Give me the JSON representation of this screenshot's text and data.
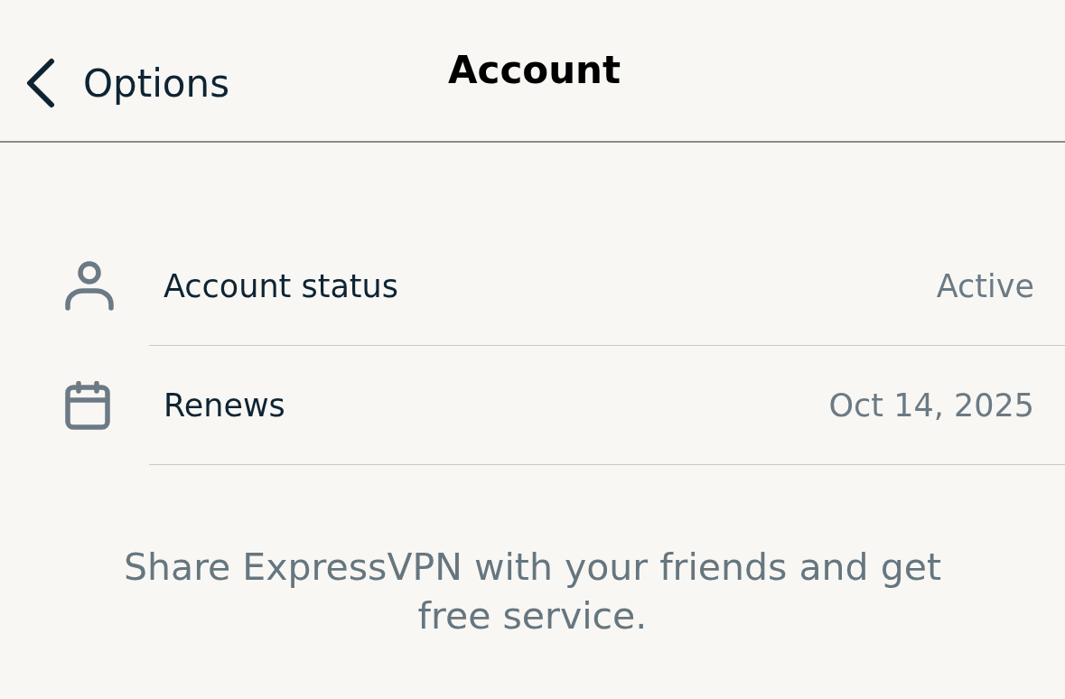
{
  "header": {
    "back_label": "Options",
    "title": "Account"
  },
  "rows": [
    {
      "kind": "person",
      "label": "Account status",
      "value": "Active"
    },
    {
      "kind": "calendar",
      "label": "Renews",
      "value": "Oct 14, 2025"
    }
  ],
  "footer": {
    "text": "Share ExpressVPN with your friends and get free service."
  }
}
